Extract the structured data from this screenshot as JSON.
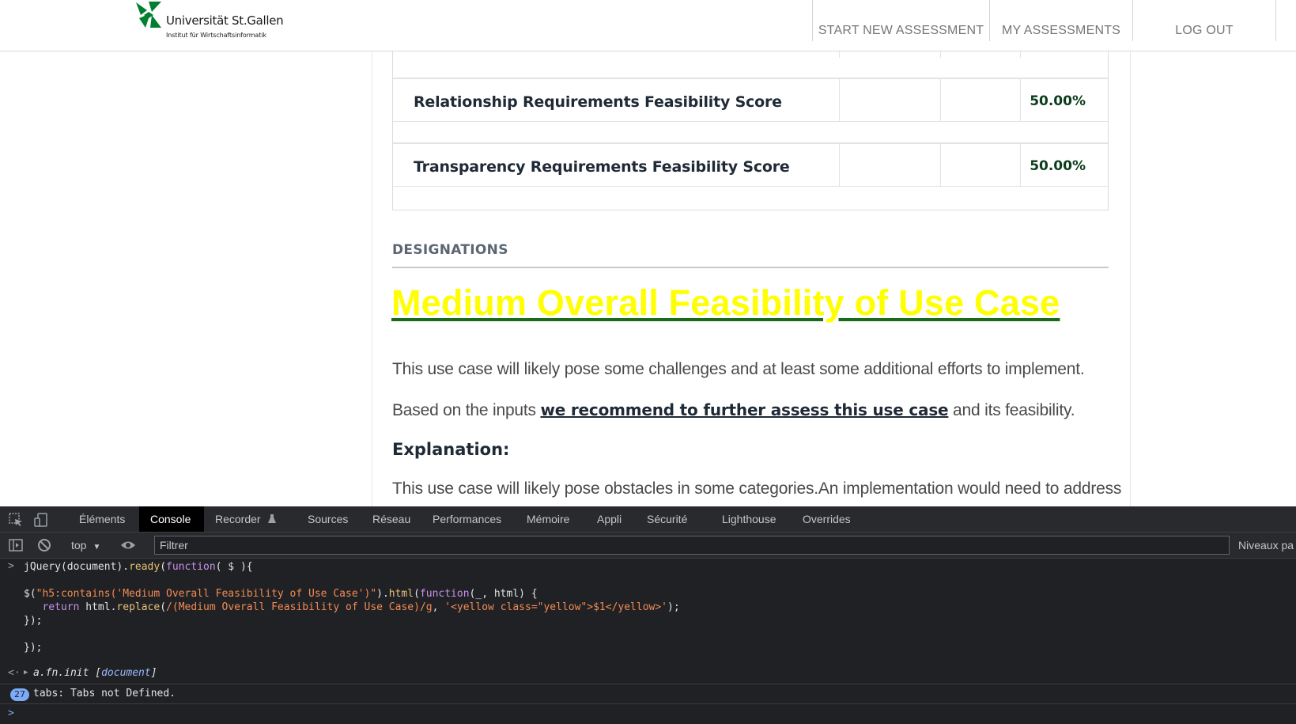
{
  "header": {
    "logo_name": "Universität St.Gallen",
    "logo_subtitle": "Institut für Wirtschaftsinformatik",
    "nav": {
      "start": "START NEW ASSESSMENT",
      "my": "MY ASSESSMENTS",
      "logout": "LOG OUT"
    }
  },
  "scores": [
    {
      "label": "Relationship Requirements Feasibility Score",
      "value": "50.00%"
    },
    {
      "label": "Transparency Requirements Feasibility Score",
      "value": "50.00%"
    }
  ],
  "designations": {
    "heading": "DESIGNATIONS",
    "title": "Medium Overall Feasibility of Use Case ",
    "para1": "This use case will likely pose some challenges and at least some additional efforts to implement.",
    "para2_prefix": "Based on the inputs ",
    "para2_link": "we recommend to further assess this use case",
    "para2_suffix": " and its feasibility.",
    "explanation_heading": "Explanation:",
    "para3": "This use case will likely pose obstacles in some categories.An implementation would need to address"
  },
  "devtools": {
    "tabs": [
      "Éléments",
      "Console",
      "Recorder",
      "Sources",
      "Réseau",
      "Performances",
      "Mémoire",
      "Appli",
      "Sécurité",
      "Lighthouse",
      "Overrides"
    ],
    "active_tab": "Console",
    "context": "top",
    "filter_placeholder": "Filtrer",
    "levels_label": "Niveaux pa",
    "code_lines": [
      "jQuery(document).ready(function( $ ){",
      "",
      "$(\"h5:contains('Medium Overall Feasibility of Use Case')\").html(function(_, html) {",
      "   return html.replace(/(Medium Overall Feasibility of Use Case)/g, '<yellow class=\"yellow\">$1</yellow>');",
      "});",
      "",
      "});"
    ],
    "result_text": "a.fn.init [",
    "result_link": "document",
    "result_close": "]",
    "error_count": "27",
    "error_text": "tabs: Tabs not Defined."
  },
  "colors": {
    "title_yellow": "#ffff00",
    "title_underline": "#1a6b1a",
    "score_green": "#0b3d1c",
    "logo_green": "#00802f",
    "devtools_bg": "#202124"
  },
  "icons": [
    "hsg-logo-icon",
    "inspect-icon",
    "device-toggle-icon",
    "flask-icon",
    "sidebar-toggle-icon",
    "clear-console-icon",
    "eye-icon",
    "chevron-down-icon",
    "result-arrow-icon",
    "expand-triangle-icon",
    "prompt-icon"
  ]
}
